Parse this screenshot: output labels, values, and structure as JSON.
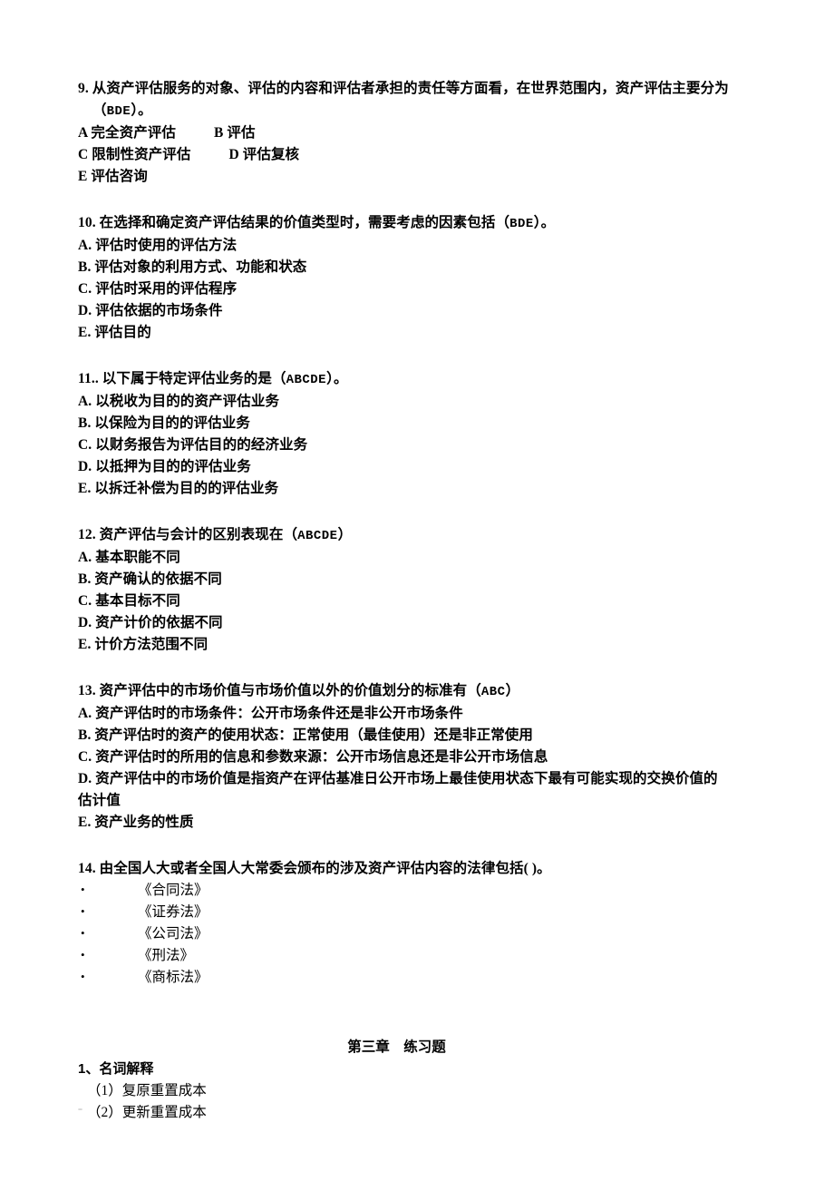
{
  "document": {
    "background_color": "#ffffff",
    "text_color": "#000000",
    "language": "zh-CN"
  },
  "questions": [
    {
      "number": "9.",
      "stem_line1": "9. 从资产评估服务的对象、评估的内容和评估者承担的责任等方面看，在世界范围内，资产评估主要分为",
      "stem_line2_prefix": "（",
      "stem_answer": "BDE",
      "stem_line2_suffix": "）。",
      "options": [
        {
          "label": "A 完全资产评估",
          "label2": "B 评估"
        },
        {
          "label": "C 限制性资产评估",
          "label2": "D 评估复核"
        },
        {
          "label": "E 评估咨询",
          "label2": ""
        }
      ]
    },
    {
      "number": "10.",
      "stem_prefix": "10. 在选择和确定资产评估结果的价值类型时，需要考虑的因素包括（",
      "stem_answer": "BDE",
      "stem_suffix": "）。",
      "options": [
        "A. 评估时使用的评估方法",
        "B. 评估对象的利用方式、功能和状态",
        "C. 评估时采用的评估程序",
        "D. 评估依据的市场条件",
        "E. 评估目的"
      ]
    },
    {
      "number": "11..",
      "stem_prefix": "11.. 以下属于特定评估业务的是（",
      "stem_answer": "ABCDE",
      "stem_suffix": "）。",
      "options": [
        "A. 以税收为目的的资产评估业务",
        "B. 以保险为目的的评估业务",
        "C. 以财务报告为评估目的的经济业务",
        "D. 以抵押为目的的评估业务",
        "E. 以拆迁补偿为目的的评估业务"
      ]
    },
    {
      "number": "12.",
      "stem_prefix": "12. 资产评估与会计的区别表现在（",
      "stem_answer": "ABCDE",
      "stem_suffix": "）",
      "options": [
        "A. 基本职能不同",
        "B. 资产确认的依据不同",
        "C. 基本目标不同",
        "D. 资产计价的依据不同",
        "E. 计价方法范围不同"
      ]
    },
    {
      "number": "13.",
      "stem_prefix": "13. 资产评估中的市场价值与市场价值以外的价值划分的标准有（",
      "stem_answer": "ABC",
      "stem_suffix": "）",
      "options": [
        "A. 资产评估时的市场条件：公开市场条件还是非公开市场条件",
        "B. 资产评估时的资产的使用状态：正常使用（最佳使用）还是非正常使用",
        "C. 资产评估时的所用的信息和参数来源：公开市场信息还是非公开市场信息"
      ],
      "option_d_line1": "D. 资产评估中的市场价值是指资产在评估基准日公开市场上最佳使用状态下最有可能实现的交换价值的",
      "option_d_line2": "估计值",
      "option_e": "E. 资产业务的性质"
    },
    {
      "number": "14.",
      "stem": "14.  由全国人大或者全国人大常委会颁布的涉及资产评估内容的法律包括( )。",
      "bullets": [
        "《合同法》",
        "《证券法》",
        "《公司法》",
        "《刑法》",
        "《商标法》"
      ]
    }
  ],
  "chapter": {
    "heading": "第三章　练习题",
    "section_title": "1、名词解释",
    "items": [
      "（1）复原重置成本",
      "（2）更新重置成本"
    ]
  }
}
